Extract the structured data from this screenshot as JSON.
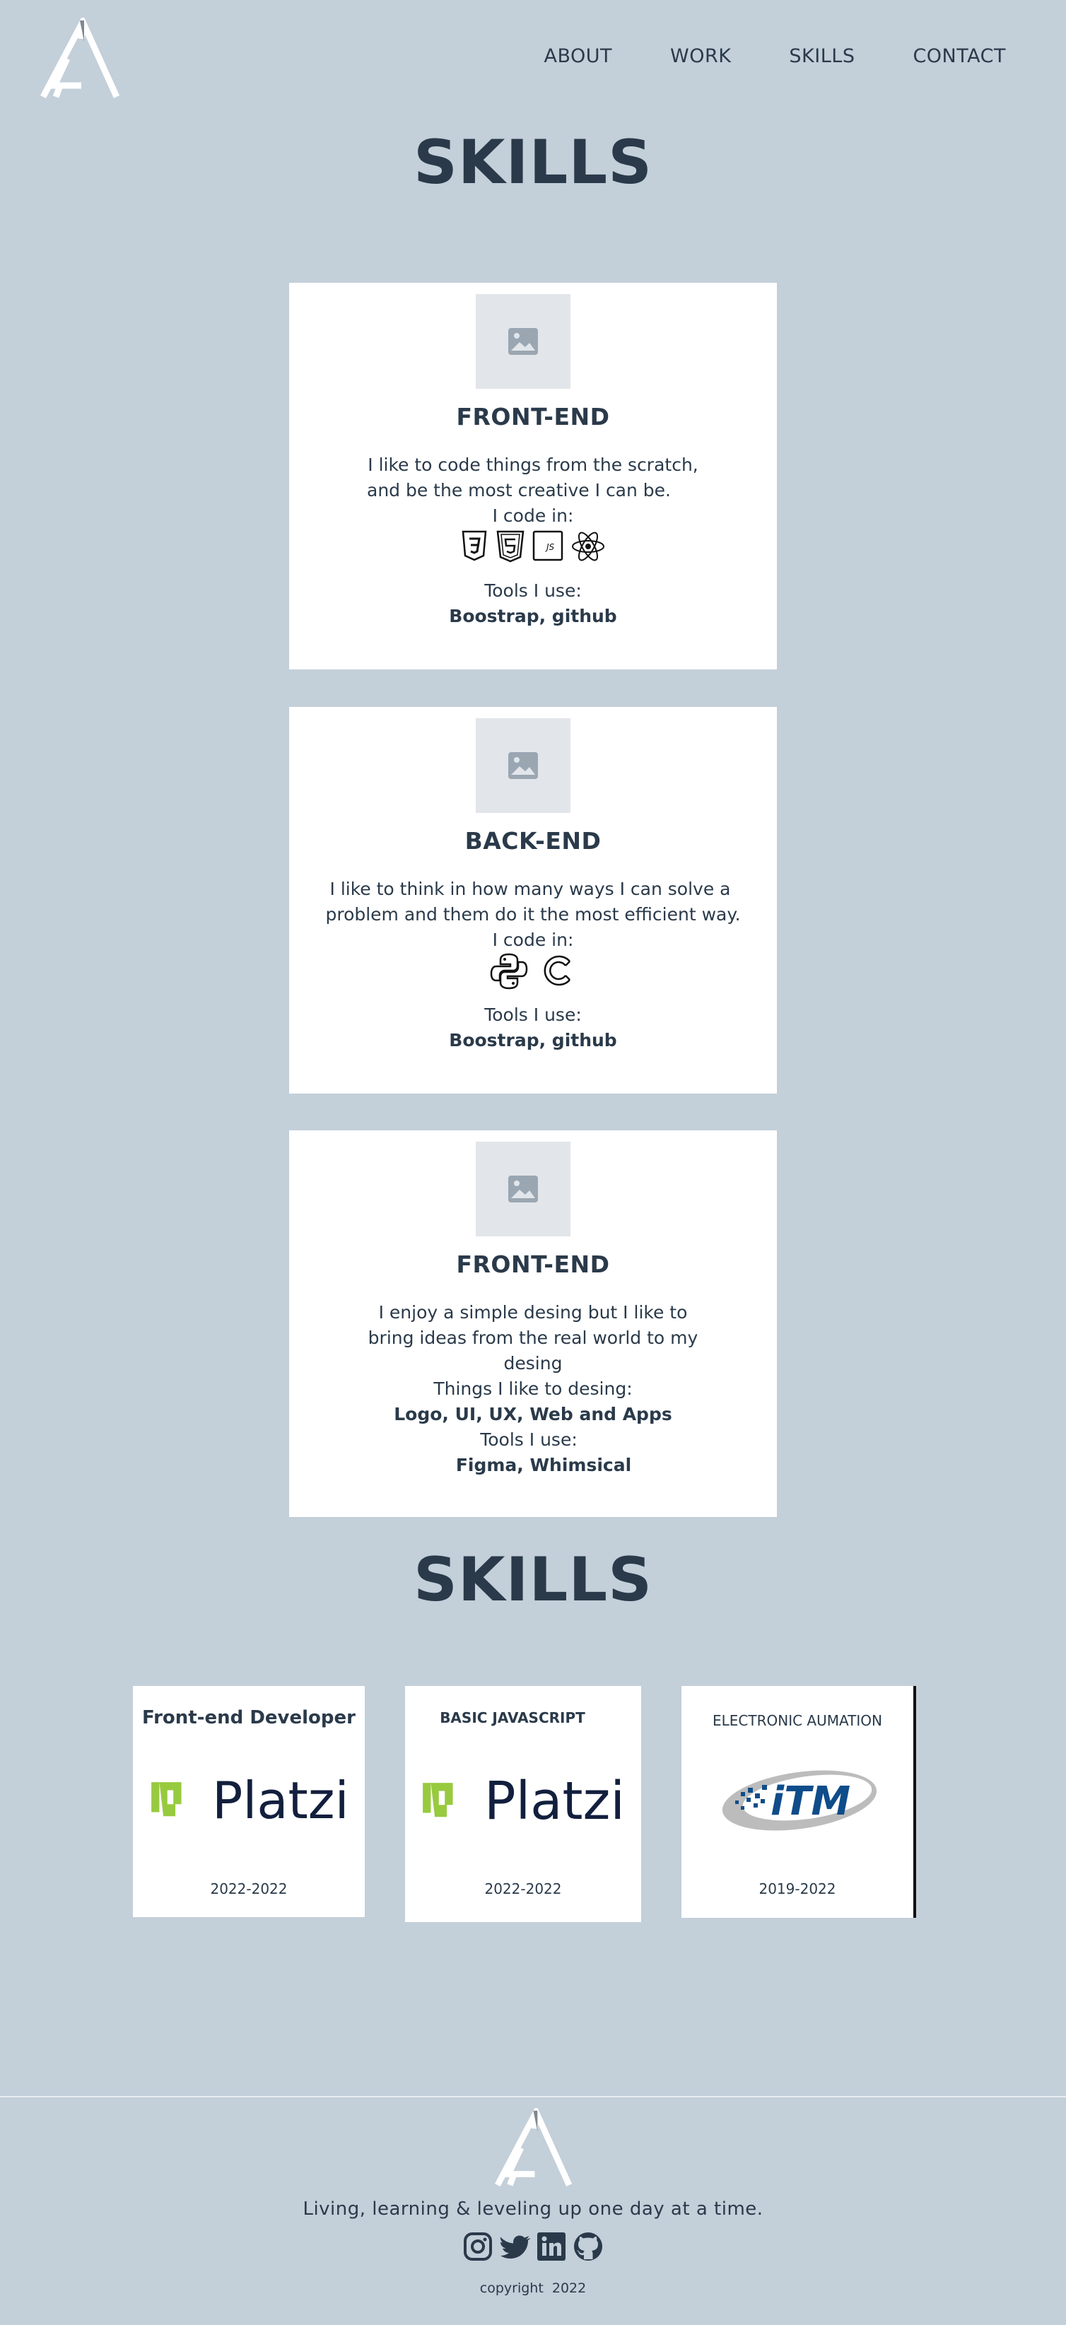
{
  "nav": {
    "items": [
      "ABOUT",
      "WORK",
      "SKILLS",
      "CONTACT"
    ]
  },
  "skills_title": "SKILLS",
  "cards": [
    {
      "title": "FRONT-END",
      "description_lines": [
        "I like to code things from the scratch,",
        "and be the most creative I can be."
      ],
      "code_label": "I code in:",
      "code_icons": [
        "css3-icon",
        "html5-icon",
        "javascript-icon",
        "react-icon"
      ],
      "tools_label": "Tools I use:",
      "tools": "Boostrap, github"
    },
    {
      "title": "BACK-END",
      "description_lines": [
        "I like to think in how many ways I can solve a",
        "problem and them do it the most efficient way."
      ],
      "code_label": "I code in:",
      "code_icons": [
        "python-icon",
        "c-language-icon"
      ],
      "tools_label": "Tools I use:",
      "tools": "Boostrap, github"
    },
    {
      "title": "FRONT-END",
      "description_lines": [
        "I enjoy a simple desing but I like to",
        "bring ideas from the real world to my",
        "desing"
      ],
      "code_label": "Things I like to desing:",
      "things": "Logo, UI, UX, Web and Apps",
      "tools_label": "Tools I use:",
      "tools": "Figma, Whimsical"
    }
  ],
  "certs_title": "SKILLS",
  "certs": [
    {
      "title": "Front-end Developer",
      "issuer": "Platzi",
      "years": "2022-2022"
    },
    {
      "title": "BASIC JAVASCRIPT",
      "issuer": "Platzi",
      "years": "2022-2022"
    },
    {
      "title": "ELECTRONIC AUMATION",
      "issuer": "iTM",
      "years": "2019-2022"
    }
  ],
  "footer": {
    "tagline": "Living, learning & leveling up one day at a time.",
    "social_icons": [
      "instagram-icon",
      "twitter-icon",
      "linkedin-icon",
      "github-icon"
    ],
    "copyright": "copyright  2022"
  },
  "colors": {
    "background": "#c3cfd9",
    "text": "#2a3a4a",
    "card": "#ffffff",
    "placeholder": "#e2e6ea",
    "platzi_green": "#98ca3f",
    "platzi_navy": "#121f3d",
    "itm_blue": "#0f4c8a"
  }
}
